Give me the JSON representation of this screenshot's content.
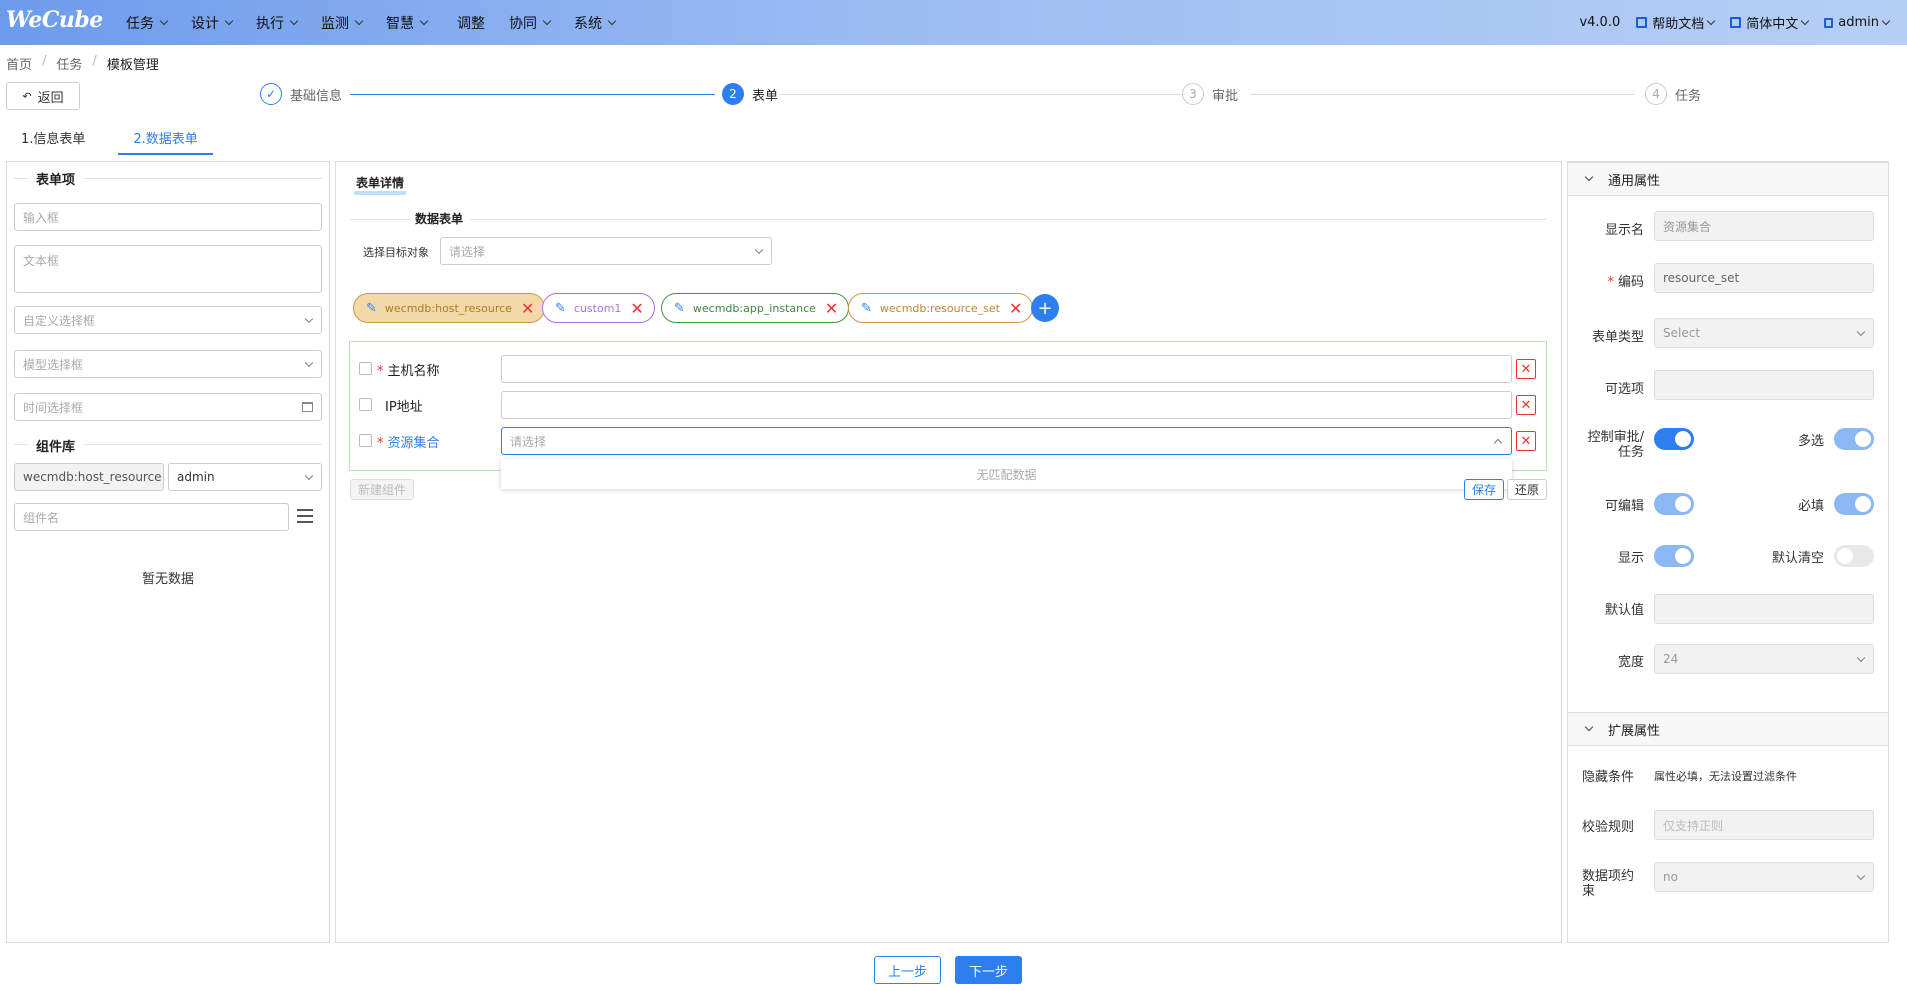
{
  "header": {
    "logo": "WeCube",
    "menu": [
      "任务",
      "设计",
      "执行",
      "监测",
      "智慧",
      "调整",
      "协同",
      "系统"
    ],
    "version": "v4.0.0",
    "help": "帮助文档",
    "language": "简体中文",
    "user": "admin"
  },
  "breadcrumb": [
    "首页",
    "任务",
    "模板管理"
  ],
  "back_label": "返回",
  "steps": [
    {
      "num": "✓",
      "label": "基础信息"
    },
    {
      "num": "2",
      "label": "表单"
    },
    {
      "num": "3",
      "label": "审批"
    },
    {
      "num": "4",
      "label": "任务"
    }
  ],
  "tabs": [
    "1.信息表单",
    "2.数据表单"
  ],
  "left_panel": {
    "form_items_title": "表单项",
    "input_placeholder": "输入框",
    "textarea_placeholder": "文本框",
    "custom_select": "自定义选择框",
    "model_select": "模型选择框",
    "time_select": "时间选择框",
    "component_lib_title": "组件库",
    "lib_entity": "wecmdb:host_resource",
    "lib_user": "admin",
    "component_name_placeholder": "组件名",
    "empty_text": "暂无数据"
  },
  "center_panel": {
    "title": "表单详情",
    "data_form_title": "数据表单",
    "target_label": "选择目标对象",
    "target_placeholder": "请选择",
    "tags": [
      "wecmdb:host_resource",
      "custom1",
      "wecmdb:app_instance",
      "wecmdb:resource_set"
    ],
    "rows": [
      {
        "label": "主机名称",
        "required": true
      },
      {
        "label": "IP地址",
        "required": false
      },
      {
        "label": "资源集合",
        "required": true
      }
    ],
    "select_placeholder": "请选择",
    "no_match": "无匹配数据",
    "new_component": "新建组件",
    "save": "保存",
    "restore": "还原"
  },
  "right_panel": {
    "general_title": "通用属性",
    "display_name_label": "显示名",
    "display_name_value": "资源集合",
    "code_label": "编码",
    "code_value": "resource_set",
    "form_type_label": "表单类型",
    "form_type_value": "Select",
    "options_label": "可选项",
    "control_label": "控制审批/任务",
    "multi_label": "多选",
    "editable_label": "可编辑",
    "required_label": "必填",
    "show_label": "显示",
    "default_clear_label": "默认清空",
    "default_value_label": "默认值",
    "width_label": "宽度",
    "width_value": "24",
    "extended_title": "扩展属性",
    "hide_cond_label": "隐藏条件",
    "hide_cond_text": "属性必填，无法设置过滤条件",
    "validate_label": "校验规则",
    "validate_placeholder": "仅支持正则",
    "constraint_label": "数据项约束",
    "constraint_value": "no"
  },
  "footer": {
    "prev": "上一步",
    "next": "下一步"
  },
  "colors": {
    "accent": "#2d7ff0",
    "danger": "#e33333",
    "toggle_on": "#2d7ff0",
    "toggle_light": "#8bb7f3"
  }
}
